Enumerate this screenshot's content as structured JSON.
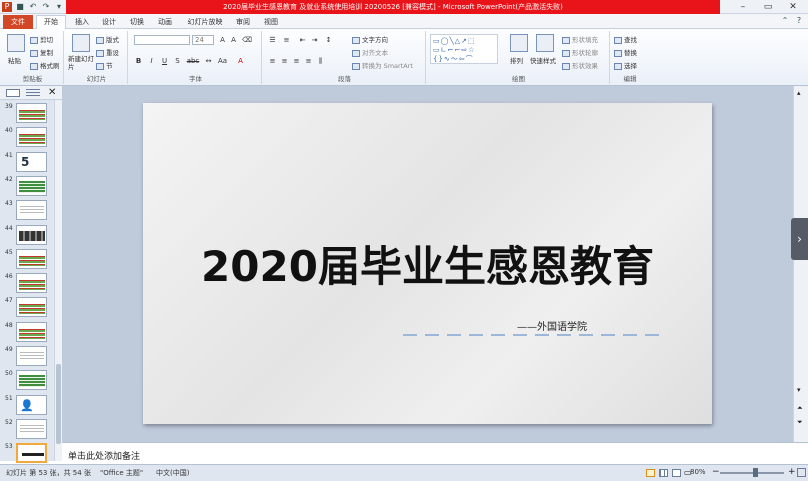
{
  "window": {
    "title": "2020届毕业生感恩教育 及就业系统使用培训 20200526 [兼容模式] - Microsoft PowerPoint(产品激活失败)",
    "min": "–",
    "max": "▭",
    "close": "✕"
  },
  "tabs": [
    "文件",
    "开始",
    "插入",
    "设计",
    "切换",
    "动画",
    "幻灯片放映",
    "审阅",
    "视图"
  ],
  "ribbon": {
    "clipboard": {
      "paste": "粘贴",
      "cut": "剪切",
      "copy": "复制",
      "painter": "格式刷",
      "label": "剪贴板"
    },
    "slides": {
      "new": "新建幻灯片",
      "layout": "版式",
      "reset": "重设",
      "section": "节",
      "label": "幻灯片"
    },
    "font": {
      "size": "24",
      "bold": "B",
      "italic": "I",
      "underline": "U",
      "shadow": "S",
      "strike": "abc",
      "label": "字体"
    },
    "paragraph": {
      "dir": "文字方向",
      "align": "对齐文本",
      "smartart": "转换为 SmartArt",
      "label": "段落"
    },
    "drawing": {
      "arrange": "排列",
      "styles": "快速样式",
      "fill": "形状填充",
      "outline": "形状轮廓",
      "effect": "形状效果",
      "label": "绘图"
    },
    "editing": {
      "find": "查找",
      "replace": "替换",
      "select": "选择",
      "label": "编辑"
    }
  },
  "thumbnails": [
    {
      "num": "39",
      "style": "rows"
    },
    {
      "num": "40",
      "style": "rows"
    },
    {
      "num": "41",
      "style": "five",
      "text": "5"
    },
    {
      "num": "42",
      "style": "green"
    },
    {
      "num": "43",
      "style": "plain"
    },
    {
      "num": "44",
      "style": "dark"
    },
    {
      "num": "45",
      "style": "rows"
    },
    {
      "num": "46",
      "style": "rows"
    },
    {
      "num": "47",
      "style": "rows"
    },
    {
      "num": "48",
      "style": "rows"
    },
    {
      "num": "49",
      "style": "plain"
    },
    {
      "num": "50",
      "style": "green"
    },
    {
      "num": "51",
      "style": "person"
    },
    {
      "num": "52",
      "style": "plain"
    },
    {
      "num": "53",
      "style": "selected"
    }
  ],
  "slide": {
    "title": "2020届毕业生感恩教育",
    "subtitle": "——外国语学院"
  },
  "notes_placeholder": "单击此处添加备注",
  "status": {
    "slide_info": "幻灯片 第 53 张，共 54 张",
    "theme": "\"Office 主题\"",
    "language": "中文(中国)",
    "zoom": "80%",
    "zoom_level": 0.55
  }
}
